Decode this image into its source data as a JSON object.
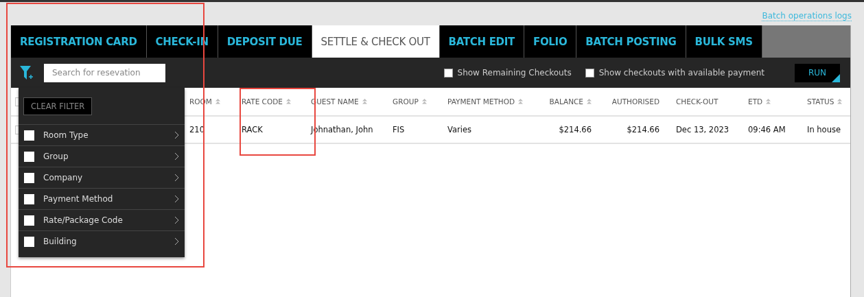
{
  "header_link": "Batch operations logs",
  "tabs": [
    {
      "label": "REGISTRATION CARD",
      "selected": false
    },
    {
      "label": "CHECK-IN",
      "selected": false
    },
    {
      "label": "DEPOSIT DUE",
      "selected": false
    },
    {
      "label": "SETTLE & CHECK OUT",
      "selected": true
    },
    {
      "label": "BATCH EDIT",
      "selected": false
    },
    {
      "label": "FOLIO",
      "selected": false
    },
    {
      "label": "BATCH POSTING",
      "selected": false
    },
    {
      "label": "BULK SMS",
      "selected": false
    }
  ],
  "toolbar": {
    "search": {
      "placeholder": "Search for resevation"
    },
    "options": [
      {
        "label": "Show Remaining Checkouts",
        "checked": false
      },
      {
        "label": "Show checkouts with available payment",
        "checked": false
      }
    ],
    "run_button": "RUN"
  },
  "table": {
    "columns": [
      {
        "label": "ROOM",
        "sortable": true,
        "numeric": false
      },
      {
        "label": "RATE CODE",
        "sortable": true,
        "numeric": false
      },
      {
        "label": "GUEST NAME",
        "sortable": true,
        "numeric": false
      },
      {
        "label": "GROUP",
        "sortable": true,
        "numeric": false
      },
      {
        "label": "PAYMENT METHOD",
        "sortable": true,
        "numeric": false
      },
      {
        "label": "BALANCE",
        "sortable": true,
        "numeric": true
      },
      {
        "label": "AUTHORISED",
        "sortable": false,
        "numeric": true
      },
      {
        "label": "CHECK-OUT",
        "sortable": false,
        "numeric": false
      },
      {
        "label": "ETD",
        "sortable": true,
        "numeric": false
      },
      {
        "label": "STATUS",
        "sortable": true,
        "numeric": false
      }
    ],
    "rows": [
      {
        "cells": [
          "210",
          "RACK",
          "Johnathan, John",
          "FIS",
          "Varies",
          "$214.66",
          "$214.66",
          "Dec 13, 2023",
          "09:46 AM",
          "In house"
        ]
      }
    ]
  },
  "filter_menu": {
    "clear_button": "CLEAR FILTER",
    "items": [
      {
        "label": "Room Type",
        "checked": false
      },
      {
        "label": "Group",
        "checked": false
      },
      {
        "label": "Company",
        "checked": false
      },
      {
        "label": "Payment Method",
        "checked": false
      },
      {
        "label": "Rate/Package Code",
        "checked": false
      },
      {
        "label": "Building",
        "checked": false
      }
    ]
  }
}
